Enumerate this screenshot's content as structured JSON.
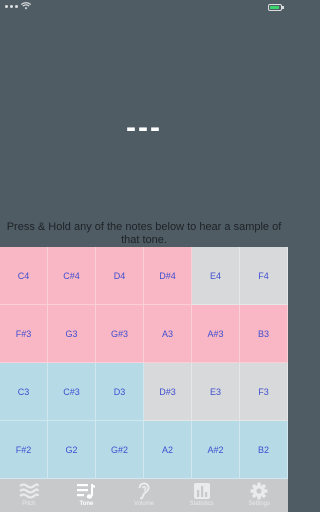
{
  "note_display": "---",
  "instruction": "Press & Hold any of the notes below to hear a sample of that tone.",
  "keys": [
    [
      "C4",
      "C#4",
      "D4",
      "D#4",
      "E4",
      "F4"
    ],
    [
      "F#3",
      "G3",
      "G#3",
      "A3",
      "A#3",
      "B3"
    ],
    [
      "C3",
      "C#3",
      "D3",
      "D#3",
      "E3",
      "F3"
    ],
    [
      "F#2",
      "G2",
      "G#2",
      "A2",
      "A#2",
      "B2"
    ]
  ],
  "tabs": [
    {
      "label": "Pitch",
      "icon": "waves-icon"
    },
    {
      "label": "Tone",
      "icon": "music-notes-icon"
    },
    {
      "label": "Volume",
      "icon": "ear-icon"
    },
    {
      "label": "Statistics",
      "icon": "bar-chart-icon"
    },
    {
      "label": "Settings",
      "icon": "gear-icon"
    }
  ],
  "colors": {
    "pink": "#f9b6c4",
    "blue": "#b7dae7",
    "gray": "#d8d9da",
    "background": "#4f5c64",
    "note_text": "#3f4fd0"
  }
}
